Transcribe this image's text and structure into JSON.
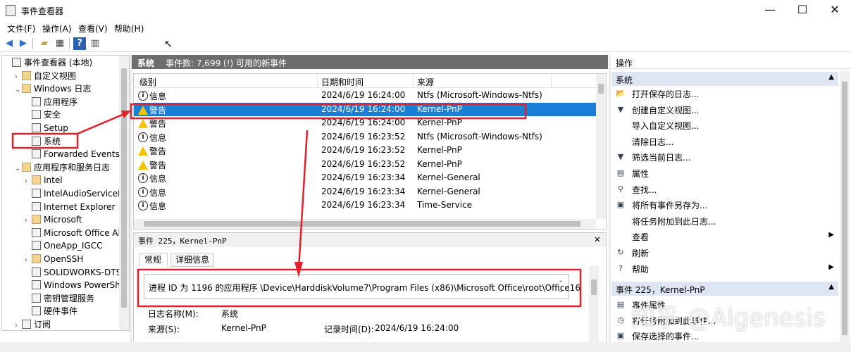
{
  "window": {
    "title": "事件查看器",
    "controls": [
      "—",
      "☐",
      "✕"
    ]
  },
  "menu": [
    "文件(F)",
    "操作(A)",
    "查看(V)",
    "帮助(H)"
  ],
  "tree": {
    "items": [
      {
        "label": "事件查看器 (本地)",
        "depth": 0,
        "arrow": "",
        "type": "root"
      },
      {
        "label": "自定义视图",
        "depth": 1,
        "arrow": "›",
        "type": "folder"
      },
      {
        "label": "Windows 日志",
        "depth": 1,
        "arrow": "⌄",
        "type": "folder"
      },
      {
        "label": "应用程序",
        "depth": 2,
        "arrow": "",
        "type": "log"
      },
      {
        "label": "安全",
        "depth": 2,
        "arrow": "",
        "type": "log"
      },
      {
        "label": "Setup",
        "depth": 2,
        "arrow": "",
        "type": "log"
      },
      {
        "label": "系统",
        "depth": 2,
        "arrow": "",
        "type": "log"
      },
      {
        "label": "Forwarded Events",
        "depth": 2,
        "arrow": "",
        "type": "log"
      },
      {
        "label": "应用程序和服务日志",
        "depth": 1,
        "arrow": "⌄",
        "type": "folder"
      },
      {
        "label": "Intel",
        "depth": 2,
        "arrow": "›",
        "type": "folder"
      },
      {
        "label": "IntelAudioServiceLo",
        "depth": 2,
        "arrow": "",
        "type": "log"
      },
      {
        "label": "Internet Explorer",
        "depth": 2,
        "arrow": "",
        "type": "log"
      },
      {
        "label": "Microsoft",
        "depth": 2,
        "arrow": "›",
        "type": "folder"
      },
      {
        "label": "Microsoft Office Ale",
        "depth": 2,
        "arrow": "",
        "type": "log"
      },
      {
        "label": "OneApp_IGCC",
        "depth": 2,
        "arrow": "",
        "type": "log"
      },
      {
        "label": "OpenSSH",
        "depth": 2,
        "arrow": "›",
        "type": "folder"
      },
      {
        "label": "SOLIDWORKS-DTS",
        "depth": 2,
        "arrow": "",
        "type": "log"
      },
      {
        "label": "Windows PowerShe",
        "depth": 2,
        "arrow": "",
        "type": "log"
      },
      {
        "label": "密钥管理服务",
        "depth": 2,
        "arrow": "",
        "type": "log"
      },
      {
        "label": "硬件事件",
        "depth": 2,
        "arrow": "",
        "type": "log"
      },
      {
        "label": "订阅",
        "depth": 1,
        "arrow": "›",
        "type": "log"
      }
    ]
  },
  "center": {
    "header_title": "系统",
    "header_count": "事件数: 7,699 (!) 可用的新事件",
    "columns": [
      "级别",
      "日期和时间",
      "来源"
    ],
    "rows": [
      {
        "level": "信息",
        "kind": "info",
        "datetime": "2024/6/19 16:24:00",
        "source": "Ntfs (Microsoft-Windows-Ntfs)",
        "selected": false
      },
      {
        "level": "警告",
        "kind": "warn",
        "datetime": "2024/6/19 16:24:00",
        "source": "Kernel-PnP",
        "selected": true
      },
      {
        "level": "警告",
        "kind": "warn",
        "datetime": "2024/6/19 16:24:00",
        "source": "Kernel-PnP",
        "selected": false
      },
      {
        "level": "信息",
        "kind": "info",
        "datetime": "2024/6/19 16:23:52",
        "source": "Ntfs (Microsoft-Windows-Ntfs)",
        "selected": false
      },
      {
        "level": "警告",
        "kind": "warn",
        "datetime": "2024/6/19 16:23:52",
        "source": "Kernel-PnP",
        "selected": false
      },
      {
        "level": "警告",
        "kind": "warn",
        "datetime": "2024/6/19 16:23:52",
        "source": "Kernel-PnP",
        "selected": false
      },
      {
        "level": "信息",
        "kind": "info",
        "datetime": "2024/6/19 16:23:34",
        "source": "Kernel-General",
        "selected": false
      },
      {
        "level": "信息",
        "kind": "info",
        "datetime": "2024/6/19 16:23:34",
        "source": "Kernel-General",
        "selected": false
      },
      {
        "level": "信息",
        "kind": "info",
        "datetime": "2024/6/19 16:23:34",
        "source": "Time-Service",
        "selected": false
      }
    ],
    "detail": {
      "title": "事件 225，Kernel-PnP",
      "tabs": [
        "常规",
        "详细信息"
      ],
      "message": "进程 ID 为 1196 的应用程序 \\Device\\HarddiskVolume7\\Program Files (x86)\\Microsoft Office\\root\\Office16",
      "log_name_label": "日志名称(M):",
      "log_name_value": "系统",
      "source_label": "来源(S):",
      "source_value": "Kernel-PnP",
      "logged_label": "记录时间(D):",
      "logged_value": "2024/6/19 16:24:00"
    }
  },
  "actions": {
    "header": "操作",
    "section1": "系统",
    "items1": [
      {
        "label": "打开保存的日志...",
        "icon": "open-log-icon",
        "glyph": "📂",
        "submenu": false
      },
      {
        "label": "创建自定义视图...",
        "icon": "filter-icon",
        "glyph": "▼",
        "submenu": false
      },
      {
        "label": "导入自定义视图...",
        "icon": "",
        "glyph": "",
        "submenu": false
      },
      {
        "label": "清除日志...",
        "icon": "",
        "glyph": "",
        "submenu": false
      },
      {
        "label": "筛选当前日志...",
        "icon": "filter-icon",
        "glyph": "▼",
        "submenu": false
      },
      {
        "label": "属性",
        "icon": "properties-icon",
        "glyph": "▤",
        "submenu": false
      },
      {
        "label": "查找...",
        "icon": "find-icon",
        "glyph": "⚲",
        "submenu": false
      },
      {
        "label": "将所有事件另存为...",
        "icon": "save-icon",
        "glyph": "▣",
        "submenu": false
      },
      {
        "label": "将任务附加到此日志...",
        "icon": "",
        "glyph": "",
        "submenu": false
      },
      {
        "label": "查看",
        "icon": "",
        "glyph": "",
        "submenu": true
      },
      {
        "label": "刷新",
        "icon": "refresh-icon",
        "glyph": "↻",
        "submenu": false
      },
      {
        "label": "帮助",
        "icon": "help-icon",
        "glyph": "?",
        "submenu": true
      }
    ],
    "section2": "事件 225，Kernel-PnP",
    "items2": [
      {
        "label": "事件属性",
        "icon": "properties-icon",
        "glyph": "▤"
      },
      {
        "label": "将任务附加到此事件...",
        "icon": "task-icon",
        "glyph": "◷"
      },
      {
        "label": "保存选择的事件...",
        "icon": "save-icon",
        "glyph": "▣"
      }
    ]
  },
  "watermark": "知乎 @Algenesis",
  "colors": {
    "selection": "#1c7dd6",
    "header_bar": "#6d6d6d",
    "annotation": "#e0202b",
    "action_section": "#dde6f2"
  }
}
